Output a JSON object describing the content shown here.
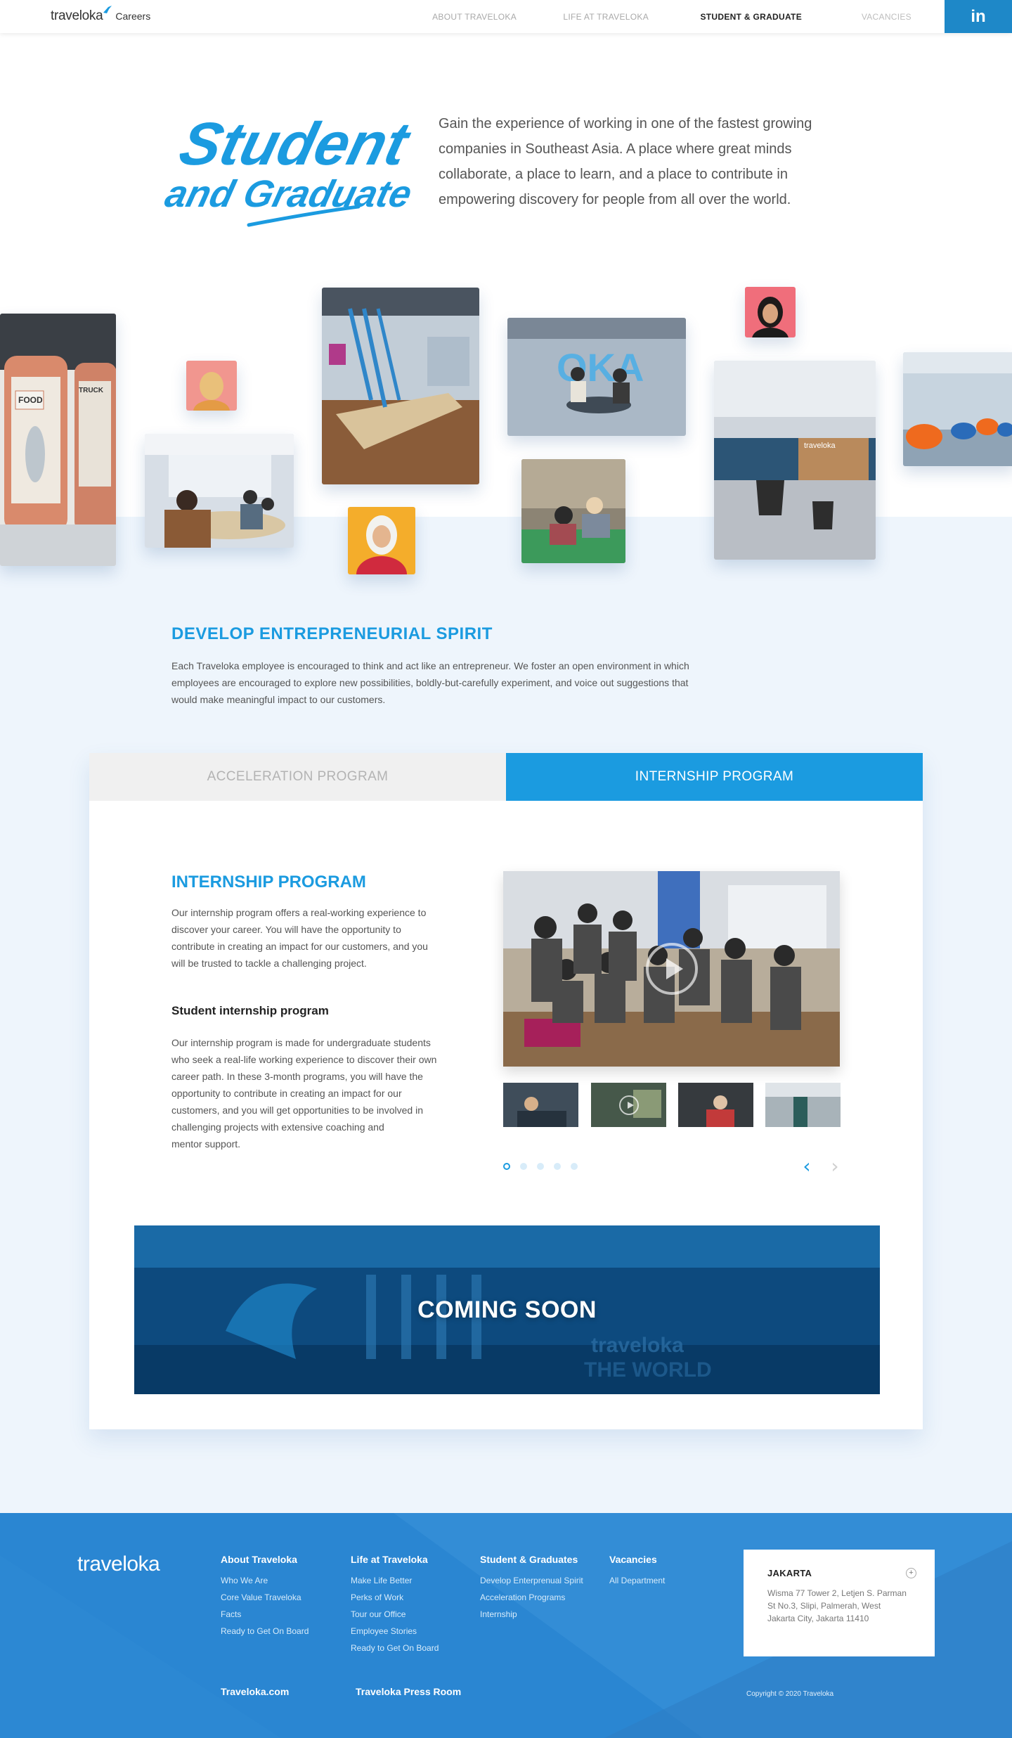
{
  "header": {
    "brand": "traveloka",
    "brand_sub": "Careers",
    "nav": [
      "ABOUT TRAVELOKA",
      "LIFE AT TRAVELOKA",
      "STUDENT & GRADUATE",
      "VACANCIES"
    ],
    "linkedin": "in"
  },
  "hero": {
    "title_line1": "Student",
    "title_line2": "and Graduate",
    "text": "Gain the experience of working in one of the fastest growing companies in Southeast Asia. A place where great minds collaborate, a place to learn, and a place to contribute in empowering discovery for people from all over the world."
  },
  "spirit": {
    "title": "DEVELOP ENTREPRENEURIAL SPIRIT",
    "text": "Each Traveloka employee is encouraged to think and act like an entrepreneur. We foster an open environment in which employees are encouraged to explore new possibilities, boldly-but-carefully experiment, and voice out suggestions that would make meaningful impact to our customers."
  },
  "program": {
    "tabs": [
      "ACCELERATION PROGRAM",
      "INTERNSHIP PROGRAM"
    ],
    "title": "INTERNSHIP PROGRAM",
    "text": "Our internship program offers a real-working experience to discover your career. You will have the opportunity to contribute in creating an impact for our customers, and you  will be trusted to tackle a challenging project.",
    "sub_title": "Student internship program",
    "sub_text": "Our internship program is made for undergraduate students who seek a real-life working experience to discover their own career path. In these 3-month programs, you will have the opportunity to contribute in creating an impact for our customers, and you will get opportunities to be involved in challenging projects with extensive coaching and",
    "sub_text_end": "mentor support.",
    "coming_soon": "COMING SOON",
    "prev_arrow": "‹",
    "next_arrow": "›"
  },
  "footer": {
    "logo": "traveloka",
    "columns": [
      {
        "title": "About Traveloka",
        "links": [
          "Who We Are",
          "Core Value Traveloka",
          "Facts",
          "Ready to Get On Board"
        ]
      },
      {
        "title": "Life at Traveloka",
        "links": [
          "Make Life Better",
          "Perks of Work",
          "Tour our Office",
          "Employee Stories",
          "Ready to Get On Board"
        ]
      },
      {
        "title": "Student & Graduates",
        "links": [
          "Develop Enterprenual Spirit",
          "Acceleration Programs",
          "Internship"
        ]
      },
      {
        "title": "Vacancies",
        "links": [
          "All Department"
        ]
      }
    ],
    "office": {
      "city": "JAKARTA",
      "address": "Wisma 77 Tower 2, Letjen S. Parman St No.3, Slipi, Palmerah, West Jakarta City, Jakarta 11410",
      "toggle": "+"
    },
    "bottom_links": [
      "Traveloka.com",
      "Traveloka Press Room"
    ],
    "copyright": "Copyright © 2020 Traveloka"
  }
}
